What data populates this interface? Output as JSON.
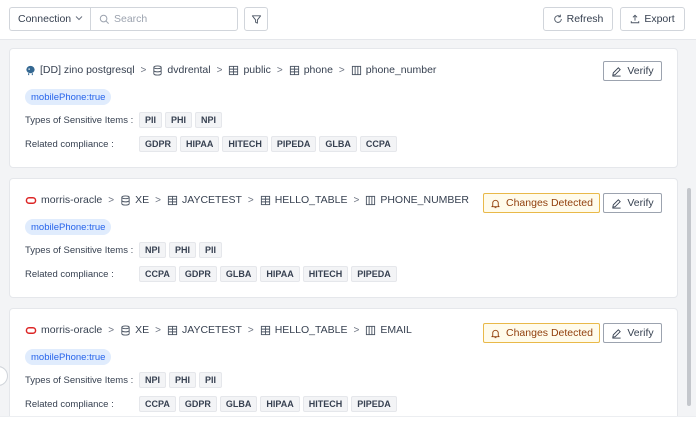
{
  "toolbar": {
    "connection_label": "Connection",
    "search_placeholder": "Search",
    "refresh_label": "Refresh",
    "export_label": "Export"
  },
  "cards": [
    {
      "path": [
        {
          "icon": "postgres-icon",
          "label": "[DD] zino postgresql"
        },
        {
          "icon": "database-icon",
          "label": "dvdrental"
        },
        {
          "icon": "schema-icon",
          "label": "public"
        },
        {
          "icon": "table-icon",
          "label": "phone"
        },
        {
          "icon": "column-icon",
          "label": "phone_number"
        }
      ],
      "badge": "mobilePhone:true",
      "types_label": "Types of Sensitive Items :",
      "types": [
        "PII",
        "PHI",
        "NPI"
      ],
      "compliance_label": "Related compliance :",
      "compliance": [
        "GDPR",
        "HIPAA",
        "HITECH",
        "PIPEDA",
        "GLBA",
        "CCPA"
      ],
      "changes_detected": null,
      "verify_label": "Verify"
    },
    {
      "path": [
        {
          "icon": "oracle-icon",
          "label": "morris-oracle"
        },
        {
          "icon": "database-icon",
          "label": "XE"
        },
        {
          "icon": "schema-icon",
          "label": "JAYCETEST"
        },
        {
          "icon": "table-icon",
          "label": "HELLO_TABLE"
        },
        {
          "icon": "column-icon",
          "label": "PHONE_NUMBER"
        }
      ],
      "badge": "mobilePhone:true",
      "types_label": "Types of Sensitive Items :",
      "types": [
        "NPI",
        "PHI",
        "PII"
      ],
      "compliance_label": "Related compliance :",
      "compliance": [
        "CCPA",
        "GDPR",
        "GLBA",
        "HIPAA",
        "HITECH",
        "PIPEDA"
      ],
      "changes_detected": "Changes Detected",
      "verify_label": "Verify"
    },
    {
      "path": [
        {
          "icon": "oracle-icon",
          "label": "morris-oracle"
        },
        {
          "icon": "database-icon",
          "label": "XE"
        },
        {
          "icon": "schema-icon",
          "label": "JAYCETEST"
        },
        {
          "icon": "table-icon",
          "label": "HELLO_TABLE"
        },
        {
          "icon": "column-icon",
          "label": "EMAIL"
        }
      ],
      "badge": "mobilePhone:true",
      "types_label": "Types of Sensitive Items :",
      "types": [
        "NPI",
        "PHI",
        "PII"
      ],
      "compliance_label": "Related compliance :",
      "compliance": [
        "CCPA",
        "GDPR",
        "GLBA",
        "HIPAA",
        "HITECH",
        "PIPEDA"
      ],
      "changes_detected": "Changes Detected",
      "verify_label": "Verify"
    }
  ],
  "colors": {
    "accent_blue": "#2563eb",
    "badge_bg": "#e0ecfd",
    "warning_border": "#e9b949",
    "warning_bg": "#fffbeb",
    "oracle_red": "#dc2626"
  }
}
